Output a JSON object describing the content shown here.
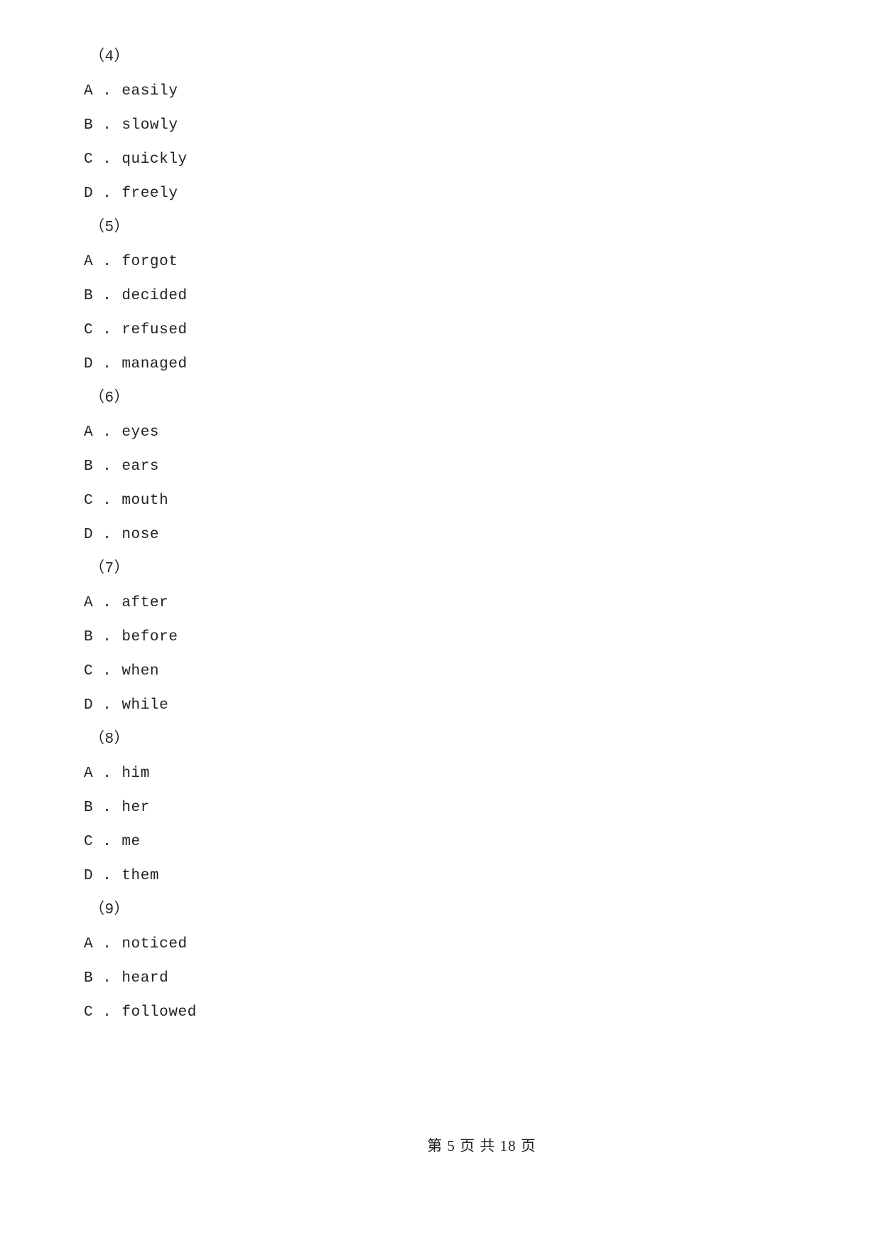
{
  "document": {
    "page_background": "#ffffff",
    "text_color": "#222222",
    "blocks": [
      {
        "number": "（4）",
        "options": [
          {
            "letter": "A .",
            "text": "easily"
          },
          {
            "letter": "B .",
            "text": "slowly"
          },
          {
            "letter": "C .",
            "text": "quickly"
          },
          {
            "letter": "D .",
            "text": "freely"
          }
        ]
      },
      {
        "number": "（5）",
        "options": [
          {
            "letter": "A .",
            "text": "forgot"
          },
          {
            "letter": "B .",
            "text": "decided"
          },
          {
            "letter": "C .",
            "text": "refused"
          },
          {
            "letter": "D .",
            "text": "managed"
          }
        ]
      },
      {
        "number": "（6）",
        "options": [
          {
            "letter": "A .",
            "text": "eyes"
          },
          {
            "letter": "B .",
            "text": "ears"
          },
          {
            "letter": "C .",
            "text": "mouth"
          },
          {
            "letter": "D .",
            "text": "nose"
          }
        ]
      },
      {
        "number": "（7）",
        "options": [
          {
            "letter": "A .",
            "text": "after"
          },
          {
            "letter": "B .",
            "text": "before"
          },
          {
            "letter": "C .",
            "text": "when"
          },
          {
            "letter": "D .",
            "text": "while"
          }
        ]
      },
      {
        "number": "（8）",
        "options": [
          {
            "letter": "A .",
            "text": "him"
          },
          {
            "letter": "B .",
            "text": "her"
          },
          {
            "letter": "C .",
            "text": "me"
          },
          {
            "letter": "D .",
            "text": "them"
          }
        ]
      },
      {
        "number": "（9）",
        "options": [
          {
            "letter": "A .",
            "text": "noticed"
          },
          {
            "letter": "B .",
            "text": "heard"
          },
          {
            "letter": "C .",
            "text": "followed"
          }
        ]
      }
    ],
    "footer": {
      "text": "第 5 页 共 18 页",
      "current_page": "5",
      "total_pages": "18"
    }
  }
}
